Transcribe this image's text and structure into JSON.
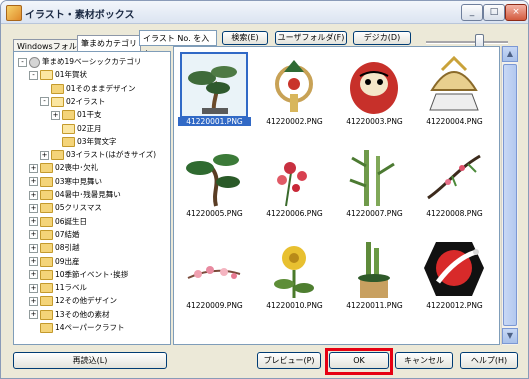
{
  "window": {
    "title": "イラスト・素材ボックス",
    "controls": {
      "minimize": "_",
      "maximize": "□",
      "close": "×"
    }
  },
  "left_tabs": [
    {
      "label": "Windowsフォルダ",
      "active": false
    },
    {
      "label": "筆まめカテゴリ",
      "active": true
    }
  ],
  "toolbar": {
    "search_value": "イラスト No. を入力",
    "search_button": "検索(E)",
    "user_folder_button": "ユーザフォルダ(F)",
    "digicam_button": "デジカ(D)"
  },
  "tree": [
    {
      "label": "筆まめ19ベーシックカテゴリ",
      "indent": 0,
      "expander": "-",
      "icon": "cd"
    },
    {
      "label": "01年賀状",
      "indent": 1,
      "expander": "-",
      "icon": "folder-open"
    },
    {
      "label": "01そのままデザイン",
      "indent": 2,
      "expander": "",
      "icon": "folder"
    },
    {
      "label": "02イラスト",
      "indent": 2,
      "expander": "-",
      "icon": "folder-open"
    },
    {
      "label": "01干支",
      "indent": 3,
      "expander": "+",
      "icon": "folder"
    },
    {
      "label": "02正月",
      "indent": 3,
      "expander": "",
      "icon": "folder-open",
      "selected": true
    },
    {
      "label": "03年賀文字",
      "indent": 3,
      "expander": "",
      "icon": "folder"
    },
    {
      "label": "03イラスト(はがきサイズ)",
      "indent": 2,
      "expander": "+",
      "icon": "folder"
    },
    {
      "label": "02喪中･欠礼",
      "indent": 1,
      "expander": "+",
      "icon": "folder"
    },
    {
      "label": "03寒中見舞い",
      "indent": 1,
      "expander": "+",
      "icon": "folder"
    },
    {
      "label": "04暑中･残暑見舞い",
      "indent": 1,
      "expander": "+",
      "icon": "folder"
    },
    {
      "label": "05クリスマス",
      "indent": 1,
      "expander": "+",
      "icon": "folder"
    },
    {
      "label": "06誕生日",
      "indent": 1,
      "expander": "+",
      "icon": "folder"
    },
    {
      "label": "07結婚",
      "indent": 1,
      "expander": "+",
      "icon": "folder"
    },
    {
      "label": "08引越",
      "indent": 1,
      "expander": "+",
      "icon": "folder"
    },
    {
      "label": "09出産",
      "indent": 1,
      "expander": "+",
      "icon": "folder"
    },
    {
      "label": "10季節イベント･挨拶",
      "indent": 1,
      "expander": "+",
      "icon": "folder"
    },
    {
      "label": "11ラベル",
      "indent": 1,
      "expander": "+",
      "icon": "folder"
    },
    {
      "label": "12その他デザイン",
      "indent": 1,
      "expander": "+",
      "icon": "folder"
    },
    {
      "label": "13その他の素材",
      "indent": 1,
      "expander": "+",
      "icon": "folder"
    },
    {
      "label": "14ペーパークラフト",
      "indent": 1,
      "expander": "",
      "icon": "folder"
    }
  ],
  "thumbnails": [
    {
      "name": "41220001.PNG",
      "art": "pine-bonsai",
      "selected": true
    },
    {
      "name": "41220002.PNG",
      "art": "rope-ornament"
    },
    {
      "name": "41220003.PNG",
      "art": "daruma"
    },
    {
      "name": "41220004.PNG",
      "art": "kabuto"
    },
    {
      "name": "41220005.PNG",
      "art": "pine-tree"
    },
    {
      "name": "41220006.PNG",
      "art": "red-flowers"
    },
    {
      "name": "41220007.PNG",
      "art": "bamboo"
    },
    {
      "name": "41220008.PNG",
      "art": "plum-branch"
    },
    {
      "name": "41220009.PNG",
      "art": "pink-blossoms"
    },
    {
      "name": "41220010.PNG",
      "art": "yellow-flower"
    },
    {
      "name": "41220011.PNG",
      "art": "kadomatsu"
    },
    {
      "name": "41220012.PNG",
      "art": "crane"
    }
  ],
  "footer": {
    "reload_button": "再読込(L)",
    "preview_button": "プレビュー(P)",
    "ok_button": "OK",
    "cancel_button": "キャンセル",
    "help_button": "ヘルプ(H)"
  },
  "colors": {
    "selection": "#3169c6",
    "highlight": "#e60012"
  }
}
